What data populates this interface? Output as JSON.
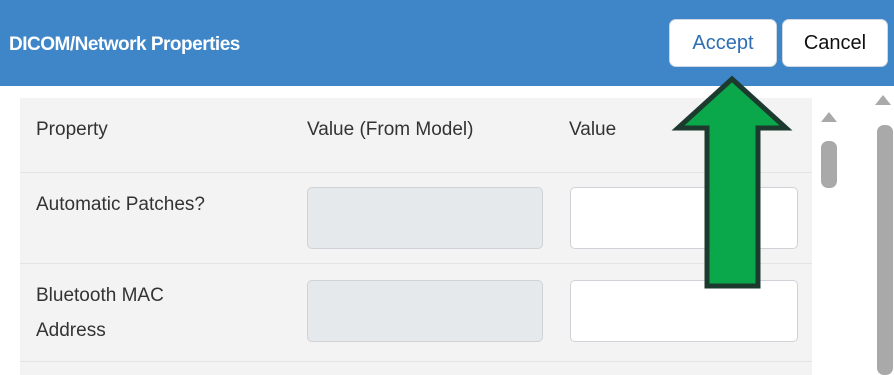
{
  "window": {
    "title": "DICOM/Network Properties",
    "accept_label": "Accept",
    "cancel_label": "Cancel"
  },
  "table": {
    "columns": [
      "Property",
      "Value (From Model)",
      "Value"
    ],
    "rows": [
      {
        "property": "Automatic Patches?",
        "model_value": "",
        "value": ""
      },
      {
        "property": "Bluetooth MAC\nAddress",
        "model_value": "",
        "value": ""
      }
    ]
  },
  "annotation": {
    "arrow_color": "#0aa84a",
    "arrow_outline": "#1c3a2e",
    "points_to": "accept-button"
  },
  "colors": {
    "header_bg": "#3f86c8",
    "accent_text": "#2d6fb2"
  }
}
